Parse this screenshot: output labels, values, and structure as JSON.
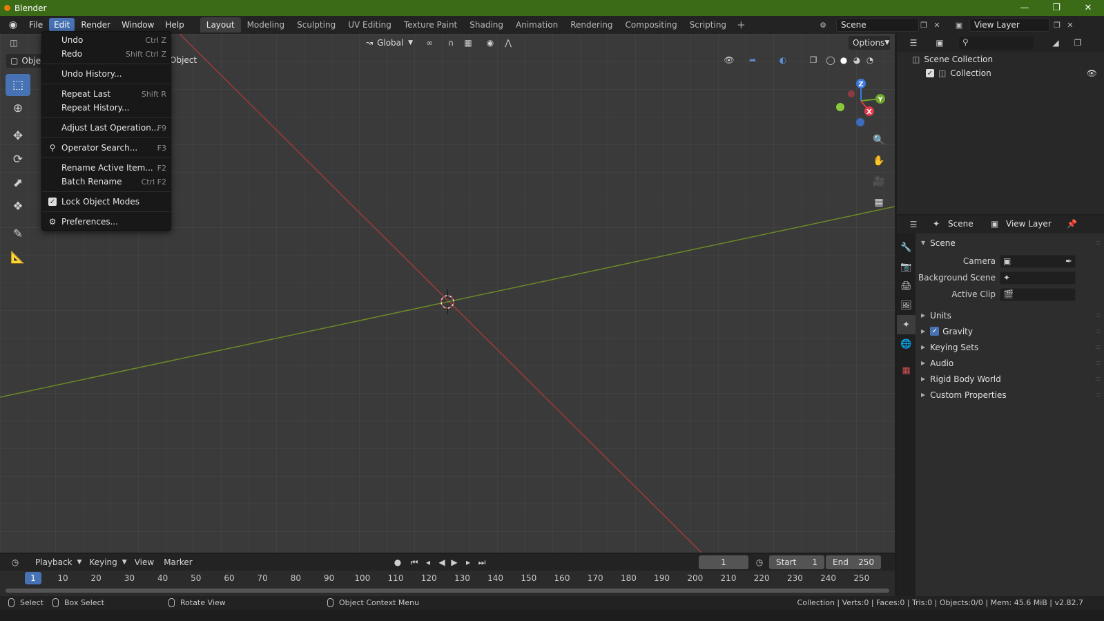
{
  "window": {
    "title": "Blender"
  },
  "menu": {
    "file": "File",
    "edit": "Edit",
    "render": "Render",
    "window": "Window",
    "help": "Help"
  },
  "workspaces": [
    "Layout",
    "Modeling",
    "Sculpting",
    "UV Editing",
    "Texture Paint",
    "Shading",
    "Animation",
    "Rendering",
    "Compositing",
    "Scripting"
  ],
  "scene_selector": "Scene",
  "view_layer_selector": "View Layer",
  "viewport": {
    "transform_orientation": "Global",
    "options_label": "Options",
    "mode_label": "Object",
    "object_menu": "Object"
  },
  "edit_menu": {
    "undo": "Undo",
    "undo_sc": "Ctrl Z",
    "redo": "Redo",
    "redo_sc": "Shift Ctrl Z",
    "undo_history": "Undo History...",
    "repeat_last": "Repeat Last",
    "repeat_last_sc": "Shift R",
    "repeat_history": "Repeat History...",
    "adjust_last": "Adjust Last Operation...",
    "adjust_last_sc": "F9",
    "operator_search": "Operator Search...",
    "operator_search_sc": "F3",
    "rename_active": "Rename Active Item...",
    "rename_active_sc": "F2",
    "batch_rename": "Batch Rename",
    "batch_rename_sc": "Ctrl F2",
    "lock_object_modes": "Lock Object Modes",
    "lock_object_modes_checked": true,
    "preferences": "Preferences..."
  },
  "gizmo": {
    "z": "Z",
    "y": "Y",
    "x": "X"
  },
  "outliner": {
    "scene_collection": "Scene Collection",
    "collection": "Collection"
  },
  "properties": {
    "scene_tab": "Scene",
    "view_layer_tab": "View Layer",
    "scene_panel": "Scene",
    "camera_label": "Camera",
    "background_scene_label": "Background Scene",
    "active_clip_label": "Active Clip",
    "panels": [
      "Units",
      "Gravity",
      "Keying Sets",
      "Audio",
      "Rigid Body World",
      "Custom Properties"
    ],
    "gravity_checked": true
  },
  "timeline": {
    "playback": "Playback",
    "keying": "Keying",
    "view": "View",
    "marker": "Marker",
    "current_frame": "1",
    "start_label": "Start",
    "start_value": "1",
    "end_label": "End",
    "end_value": "250",
    "ruler_current": "1",
    "ticks": [
      "10",
      "20",
      "30",
      "40",
      "50",
      "60",
      "70",
      "80",
      "90",
      "100",
      "110",
      "120",
      "130",
      "140",
      "150",
      "160",
      "170",
      "180",
      "190",
      "200",
      "210",
      "220",
      "230",
      "240",
      "250"
    ]
  },
  "statusbar": {
    "select": "Select",
    "box_select": "Box Select",
    "rotate_view": "Rotate View",
    "context_menu": "Object Context Menu",
    "stats": "Collection | Verts:0 | Faces:0 | Tris:0 | Objects:0/0 | Mem: 45.6 MiB | v2.82.7"
  }
}
